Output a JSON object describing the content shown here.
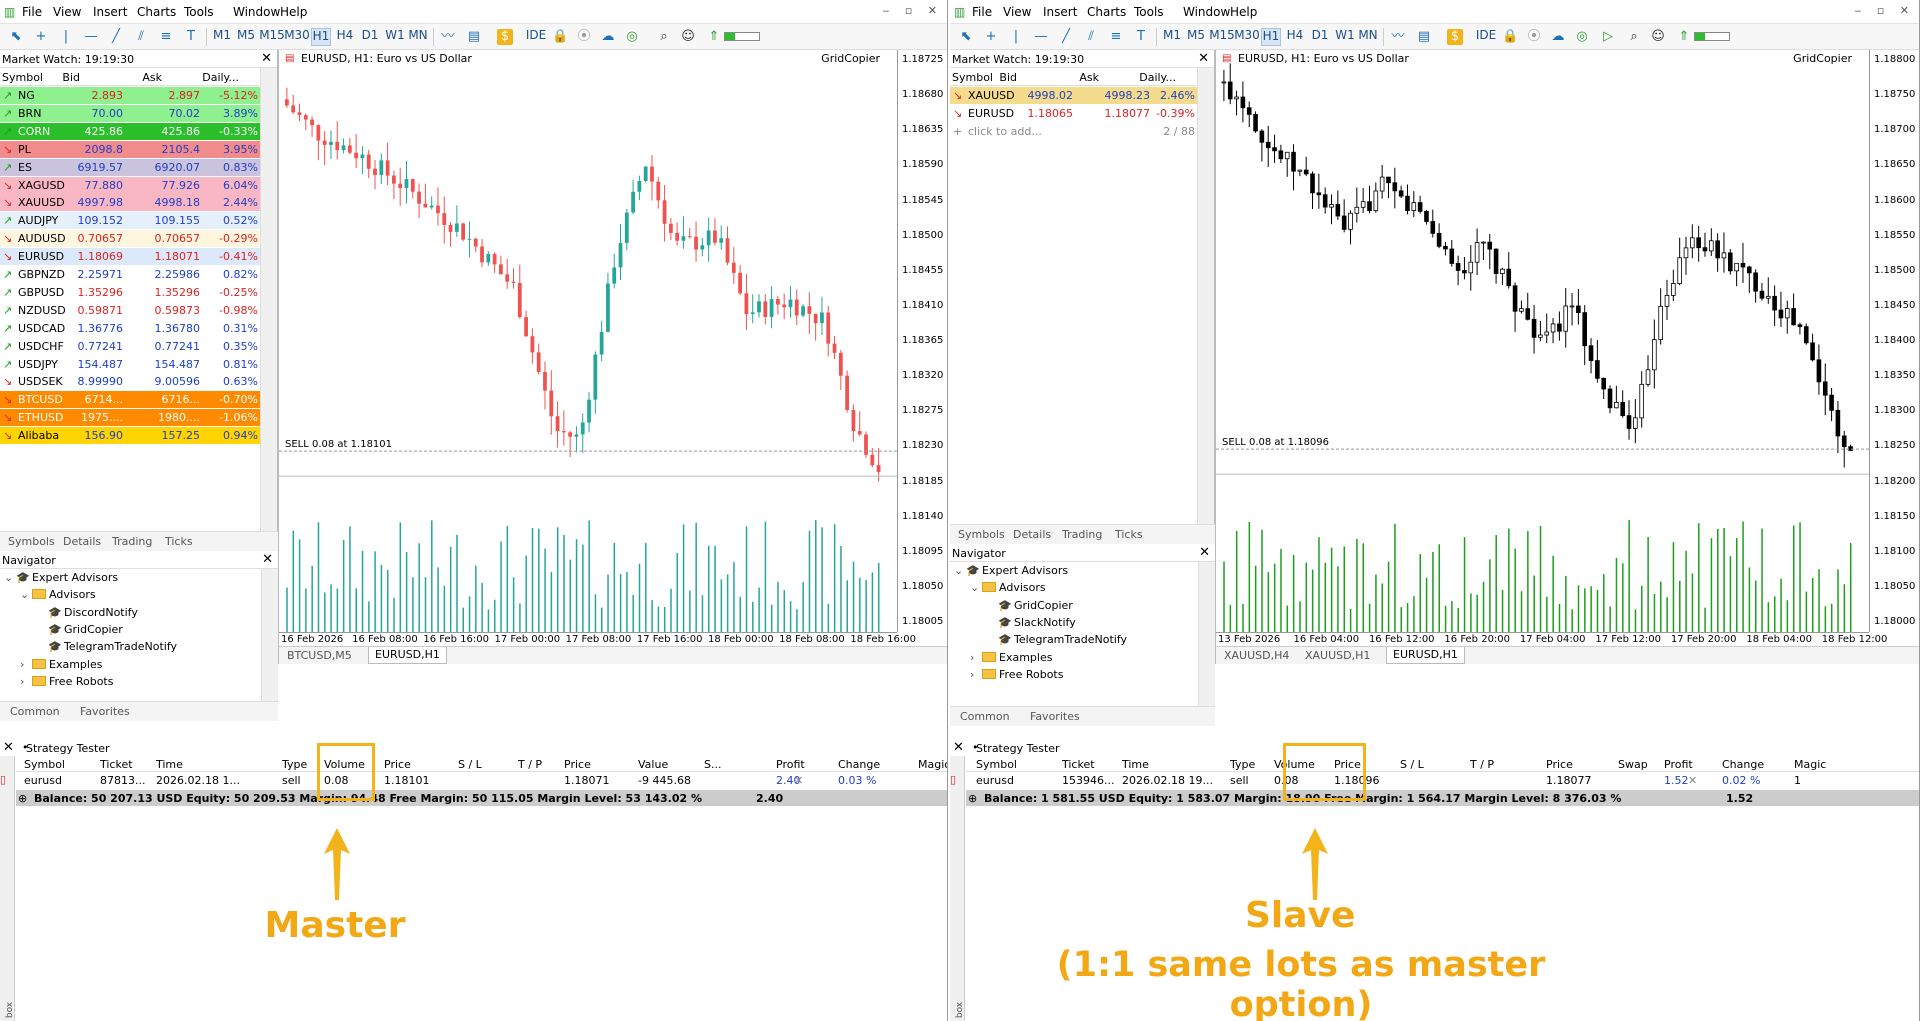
{
  "menu": [
    "File",
    "View",
    "Insert",
    "Charts",
    "Tools",
    "Window",
    "Help"
  ],
  "timeframes": [
    "M1",
    "M5",
    "M15",
    "M30",
    "H1",
    "H4",
    "D1",
    "W1",
    "MN"
  ],
  "toolbar_ide": "IDE",
  "left": {
    "market_watch": {
      "title": "Market Watch: 19:19:30",
      "cols": [
        "Symbol",
        "Bid",
        "Ask",
        "Daily..."
      ],
      "rows": [
        {
          "s": "NG",
          "b": "2.893",
          "a": "2.897",
          "c": "-5.12%",
          "bg": "#8ef08e",
          "dir": "up"
        },
        {
          "s": "BRN",
          "b": "70.00",
          "a": "70.02",
          "c": "3.89%",
          "bg": "#8ef08e",
          "dir": "up"
        },
        {
          "s": "CORN",
          "b": "425.86",
          "a": "425.86",
          "c": "-0.33%",
          "bg": "#2bbf2b",
          "dir": "up",
          "white": true
        },
        {
          "s": "PL",
          "b": "2098.8",
          "a": "2105.4",
          "c": "3.95%",
          "bg": "#f28b8b",
          "dir": "down"
        },
        {
          "s": "ES",
          "b": "6919.57",
          "a": "6920.07",
          "c": "0.83%",
          "bg": "#c9c3de",
          "dir": "up"
        },
        {
          "s": "XAGUSD",
          "b": "77.880",
          "a": "77.926",
          "c": "6.04%",
          "bg": "#f9b7c3",
          "dir": "down"
        },
        {
          "s": "XAUUSD",
          "b": "4997.98",
          "a": "4998.18",
          "c": "2.44%",
          "bg": "#f9b7c3",
          "dir": "down"
        },
        {
          "s": "AUDJPY",
          "b": "109.152",
          "a": "109.155",
          "c": "0.52%",
          "bg": "#e6f0fb",
          "dir": "up"
        },
        {
          "s": "AUDUSD",
          "b": "0.70657",
          "a": "0.70657",
          "c": "-0.29%",
          "bg": "#fff6e0",
          "dir": "down"
        },
        {
          "s": "EURUSD",
          "b": "1.18069",
          "a": "1.18071",
          "c": "-0.41%",
          "bg": "#dbe9fb",
          "dir": "down"
        },
        {
          "s": "GBPNZD",
          "b": "2.25971",
          "a": "2.25986",
          "c": "0.82%",
          "bg": "#ffffff",
          "dir": "up"
        },
        {
          "s": "GBPUSD",
          "b": "1.35296",
          "a": "1.35296",
          "c": "-0.25%",
          "bg": "#ffffff",
          "dir": "up"
        },
        {
          "s": "NZDUSD",
          "b": "0.59871",
          "a": "0.59873",
          "c": "-0.98%",
          "bg": "#ffffff",
          "dir": "up"
        },
        {
          "s": "USDCAD",
          "b": "1.36776",
          "a": "1.36780",
          "c": "0.31%",
          "bg": "#ffffff",
          "dir": "up"
        },
        {
          "s": "USDCHF",
          "b": "0.77241",
          "a": "0.77241",
          "c": "0.35%",
          "bg": "#ffffff",
          "dir": "up"
        },
        {
          "s": "USDJPY",
          "b": "154.487",
          "a": "154.487",
          "c": "0.81%",
          "bg": "#ffffff",
          "dir": "up"
        },
        {
          "s": "USDSEK",
          "b": "8.99990",
          "a": "9.00596",
          "c": "0.63%",
          "bg": "#ffffff",
          "dir": "down"
        },
        {
          "s": "BTCUSD",
          "b": "6714...",
          "a": "6716...",
          "c": "-0.70%",
          "bg": "#ff8a00",
          "dir": "down",
          "white": true
        },
        {
          "s": "ETHUSD",
          "b": "1975....",
          "a": "1980....",
          "c": "-1.06%",
          "bg": "#ff8a00",
          "dir": "down",
          "white": true
        },
        {
          "s": "Alibaba",
          "b": "156.90",
          "a": "157.25",
          "c": "0.94%",
          "bg": "#ffd400",
          "dir": "down"
        }
      ],
      "tabs": [
        "Symbols",
        "Details",
        "Trading",
        "Ticks"
      ]
    },
    "navigator": {
      "title": "Navigator",
      "items": [
        {
          "t": "Expert Advisors",
          "kind": "hat",
          "lvl": 0
        },
        {
          "t": "Advisors",
          "kind": "folder",
          "lvl": 1
        },
        {
          "t": "DiscordNotify",
          "kind": "hat",
          "lvl": 2
        },
        {
          "t": "GridCopier",
          "kind": "hat",
          "lvl": 2
        },
        {
          "t": "TelegramTradeNotify",
          "kind": "hat",
          "lvl": 2
        },
        {
          "t": "Examples",
          "kind": "folder",
          "lvl": 1
        },
        {
          "t": "Free Robots",
          "kind": "folder",
          "lvl": 1
        }
      ],
      "tabs": [
        "Common",
        "Favorites"
      ]
    },
    "chart": {
      "title": "EURUSD, H1:  Euro vs US Dollar",
      "ea": "GridCopier",
      "prices": [
        "1.18725",
        "1.18680",
        "1.18635",
        "1.18590",
        "1.18545",
        "1.18500",
        "1.18455",
        "1.18410",
        "1.18365",
        "1.18320",
        "1.18275",
        "1.18230",
        "1.18185",
        "1.18140",
        "1.18095",
        "1.18050",
        "1.18005"
      ],
      "current": "1.18069",
      "order_label": "SELL 0.08 at 1.18101",
      "times": [
        "16 Feb 2026",
        "16 Feb 08:00",
        "16 Feb 16:00",
        "17 Feb 00:00",
        "17 Feb 08:00",
        "17 Feb 16:00",
        "18 Feb 00:00",
        "18 Feb 08:00",
        "18 Feb 16:00"
      ],
      "tabs": [
        "BTCUSD,M5",
        "EURUSD,H1"
      ],
      "style": "color"
    },
    "tester": {
      "title": "Strategy Tester",
      "cols": [
        "Symbol",
        "Ticket",
        "Time",
        "Type",
        "Volume",
        "Price",
        "S / L",
        "T / P",
        "Price",
        "Value",
        "S...",
        "Profit",
        "Change",
        "Magic"
      ],
      "row": [
        "eurusd",
        "87813...",
        "2026.02.18 1...",
        "sell",
        "0.08",
        "1.18101",
        "",
        "",
        "1.18071",
        "-9 445.68",
        "",
        "2.40",
        "0.03 %",
        ""
      ],
      "balance": "Balance: 50 207.13 USD  Equity: 50 209.53  Margin: 94.48  Free Margin: 50 115.05  Margin Level: 53 143.02 %",
      "balance_profit": "2.40"
    },
    "label": "Master"
  },
  "right": {
    "market_watch": {
      "title": "Market Watch: 19:19:30",
      "cols": [
        "Symbol",
        "Bid",
        "Ask",
        "Daily..."
      ],
      "rows": [
        {
          "s": "XAUUSD",
          "b": "4998.02",
          "a": "4998.23",
          "c": "2.46%",
          "bg": "#f5dc8c",
          "dir": "down"
        },
        {
          "s": "EURUSD",
          "b": "1.18065",
          "a": "1.18077",
          "c": "-0.39%",
          "bg": "#ffffff",
          "dir": "down"
        }
      ],
      "add": "click to add...",
      "count": "2 / 88",
      "tabs": [
        "Symbols",
        "Details",
        "Trading",
        "Ticks"
      ]
    },
    "navigator": {
      "title": "Navigator",
      "items": [
        {
          "t": "Expert Advisors",
          "kind": "hat",
          "lvl": 0
        },
        {
          "t": "Advisors",
          "kind": "folder",
          "lvl": 1
        },
        {
          "t": "GridCopier",
          "kind": "hat",
          "lvl": 2
        },
        {
          "t": "SlackNotify",
          "kind": "hat",
          "lvl": 2
        },
        {
          "t": "TelegramTradeNotify",
          "kind": "hat",
          "lvl": 2
        },
        {
          "t": "Examples",
          "kind": "folder",
          "lvl": 1
        },
        {
          "t": "Free Robots",
          "kind": "folder",
          "lvl": 1
        }
      ],
      "tabs": [
        "Common",
        "Favorites"
      ]
    },
    "chart": {
      "title": "EURUSD, H1:  Euro vs US Dollar",
      "ea": "GridCopier",
      "prices": [
        "1.18800",
        "1.18750",
        "1.18700",
        "1.18650",
        "1.18600",
        "1.18550",
        "1.18500",
        "1.18450",
        "1.18400",
        "1.18350",
        "1.18300",
        "1.18250",
        "1.18200",
        "1.18150",
        "1.18100",
        "1.18050",
        "1.18000"
      ],
      "current": "1.18065",
      "order_label": "SELL 0.08 at 1.18096",
      "times": [
        "13 Feb 2026",
        "16 Feb 04:00",
        "16 Feb 12:00",
        "16 Feb 20:00",
        "17 Feb 04:00",
        "17 Feb 12:00",
        "17 Feb 20:00",
        "18 Feb 04:00",
        "18 Feb 12:00"
      ],
      "tabs": [
        "XAUUSD,H4",
        "XAUUSD,H1",
        "EURUSD,H1"
      ],
      "style": "mono"
    },
    "tester": {
      "title": "Strategy Tester",
      "cols": [
        "Symbol",
        "Ticket",
        "Time",
        "Type",
        "Volume",
        "Price",
        "S / L",
        "T / P",
        "Price",
        "Swap",
        "Profit",
        "Change",
        "Magic"
      ],
      "row": [
        "eurusd",
        "153946...",
        "2026.02.18 19...",
        "sell",
        "0.08",
        "1.18096",
        "",
        "",
        "1.18077",
        "",
        "1.52",
        "0.02 %",
        "1"
      ],
      "balance": "Balance: 1 581.55 USD  Equity: 1 583.07  Margin: 18.90  Free Margin: 1 564.17  Margin Level: 8 376.03 %",
      "balance_profit": "1.52"
    },
    "label": "Slave",
    "sublabel": "(1:1 same lots as master option)"
  },
  "colors": {
    "bull": "#26a69a",
    "bear": "#ef5350",
    "accent": "#f2b31b",
    "volume_left": "#26a69a",
    "volume_right": "#1e9e1e"
  }
}
